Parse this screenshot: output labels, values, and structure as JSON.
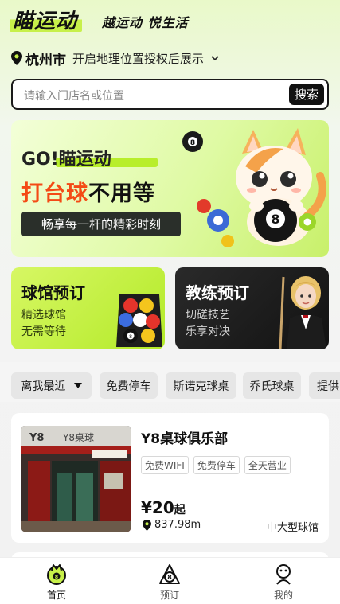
{
  "header": {
    "logo_text": "瞄运动",
    "slogan": "越运动 悦生活"
  },
  "location": {
    "city": "杭州市",
    "hint": "开启地理位置授权后展示"
  },
  "search": {
    "placeholder": "请输入门店名或位置",
    "button_label": "搜索"
  },
  "banner": {
    "line1": "GO!瞄运动",
    "line2_part1": "打台球",
    "line2_part2": "不用等",
    "line3": "畅享每一杆的精彩时刻"
  },
  "booking": {
    "venue": {
      "title": "球馆预订",
      "sub1": "精选球馆",
      "sub2": "无需等待"
    },
    "coach": {
      "title": "教练预订",
      "sub1": "切磋技艺",
      "sub2": "乐享对决"
    }
  },
  "filters": [
    "离我最近",
    "免费停车",
    "斯诺克球桌",
    "乔氏球桌",
    "提供"
  ],
  "venue": {
    "name": "Y8桌球俱乐部",
    "tags": [
      "免费WIFI",
      "免费停车",
      "全天营业"
    ],
    "price": "¥20",
    "price_suffix": "起",
    "distance": "837.98m",
    "type": "中大型球馆",
    "photo_sign": "Y8桌球"
  },
  "tabbar": [
    {
      "label": "首页",
      "icon": "home-icon",
      "active": true
    },
    {
      "label": "预订",
      "icon": "booking-icon",
      "active": false
    },
    {
      "label": "我的",
      "icon": "profile-icon",
      "active": false
    }
  ],
  "colors": {
    "accent_green": "#b8ee2b",
    "accent_red": "#f44a15",
    "dark": "#111111"
  }
}
